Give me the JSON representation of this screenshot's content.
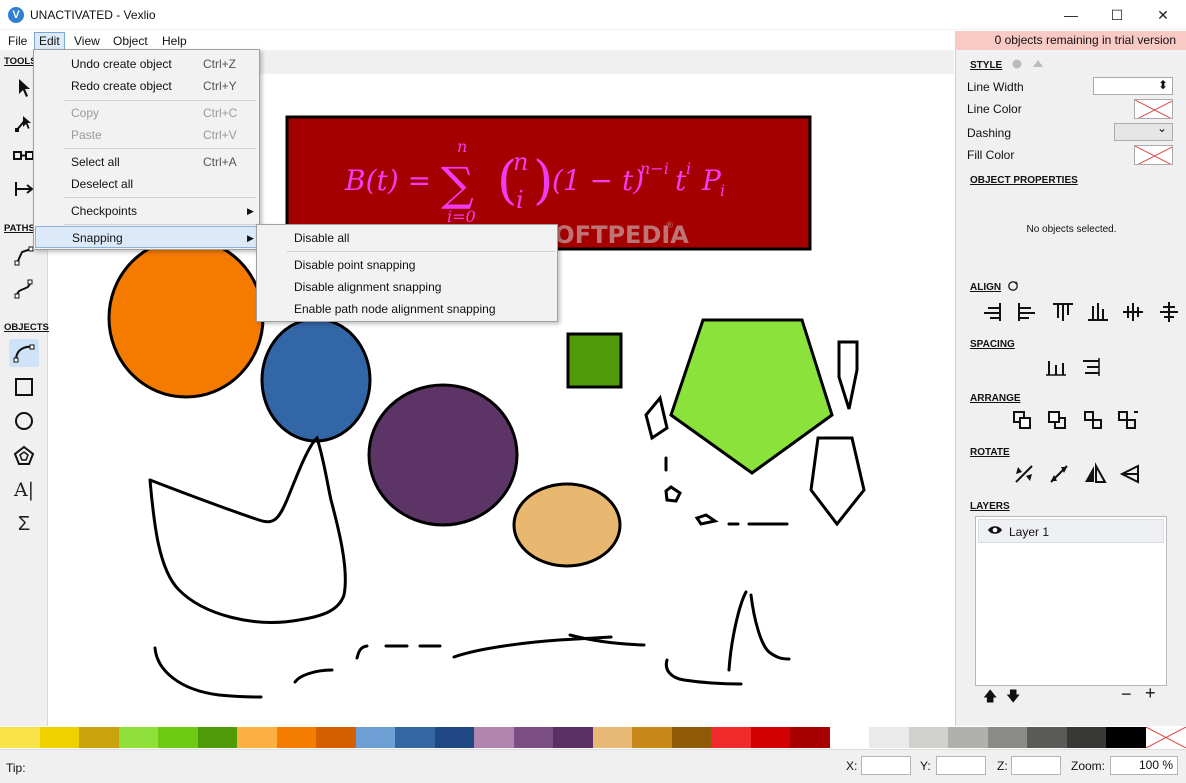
{
  "window": {
    "title": "UNACTIVATED - Vexlio",
    "app_icon": "V",
    "minimize_icon": "—",
    "maximize_icon": "☐",
    "close_icon": "✕"
  },
  "menubar": {
    "file": "File",
    "edit": "Edit",
    "view": "View",
    "object": "Object",
    "help": "Help"
  },
  "trial_banner": "0 objects remaining in trial version",
  "toolbox": {
    "tools_label": "TOOLS",
    "paths_label": "PATHS",
    "objects_label": "OBJECTS",
    "text_tool_glyph": "A|",
    "equation_tool_glyph": "Σ"
  },
  "edit_menu": {
    "undo": "Undo create object",
    "undo_shortcut": "Ctrl+Z",
    "redo": "Redo create object",
    "redo_shortcut": "Ctrl+Y",
    "copy": "Copy",
    "copy_shortcut": "Ctrl+C",
    "paste": "Paste",
    "paste_shortcut": "Ctrl+V",
    "select_all": "Select all",
    "select_all_shortcut": "Ctrl+A",
    "deselect_all": "Deselect all",
    "checkpoints": "Checkpoints",
    "snapping": "Snapping",
    "submenu_arrow": "▶"
  },
  "snapping_menu": {
    "disable_all": "Disable all",
    "disable_point": "Disable point snapping",
    "disable_alignment": "Disable alignment snapping",
    "enable_path_node": "Enable path node alignment snapping"
  },
  "canvas": {
    "equation_text": "B(t) = Σ (n i) (1 − t)^(n−i) t^i P_i",
    "eq_parts": {
      "lhs": "B(t) =",
      "sigma": "∑",
      "sum_top": "n",
      "sum_bottom": "i=0",
      "binom_top": "n",
      "binom_bottom": "i",
      "rhs": "(1 − t)",
      "exp1": "n−i",
      "t": "t",
      "exp2": "i",
      "p": "P",
      "p_sub": "i"
    },
    "watermark": "SOFTPEDIA",
    "watermark_mark": "®"
  },
  "style_panel": {
    "style_heading": "STYLE",
    "line_width_label": "Line Width",
    "line_color_label": "Line Color",
    "dashing_label": "Dashing",
    "fill_color_label": "Fill Color",
    "object_properties_heading": "OBJECT PROPERTIES",
    "no_selection_text": "No objects selected.",
    "align_heading": "ALIGN",
    "spacing_heading": "SPACING",
    "arrange_heading": "ARRANGE",
    "rotate_heading": "ROTATE",
    "layers_heading": "LAYERS",
    "layer_name": "Layer 1",
    "dropdown_arrow": "⌄",
    "spinner_arrows": "⬍",
    "move_up_icon": "🡅",
    "move_down_icon": "🡇",
    "remove_layer_icon": "−",
    "add_layer_icon": "+"
  },
  "palette_colors": [
    "#f9e14a",
    "#efd100",
    "#c9a20c",
    "#8fe03a",
    "#6ecb14",
    "#4f9a08",
    "#fbb041",
    "#f47c00",
    "#d45f00",
    "#6d9fd4",
    "#3466a4",
    "#1f4884",
    "#b185b0",
    "#7c4f84",
    "#5b3163",
    "#e7b975",
    "#c98619",
    "#8f5a06",
    "#f02a2a",
    "#d20000",
    "#a80000",
    "#ffffff",
    "#eaeaea",
    "#d0d0cc",
    "#b0b0ac",
    "#8a8a86",
    "#5a5a56",
    "#383836",
    "#000000"
  ],
  "statusbar": {
    "tip_label": "Tip:",
    "x_label": "X:",
    "y_label": "Y:",
    "z_label": "Z:",
    "zoom_label": "Zoom:",
    "zoom_value": "100 %"
  }
}
